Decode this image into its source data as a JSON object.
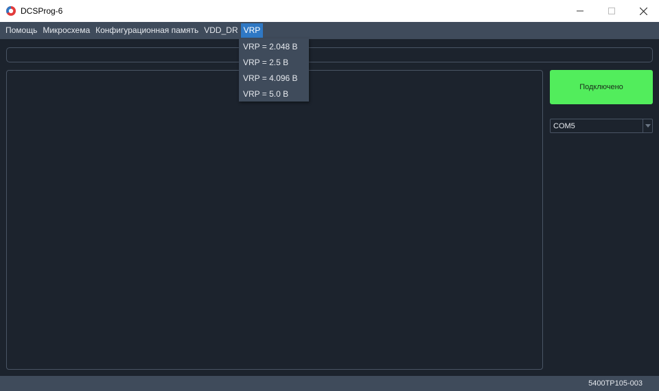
{
  "window": {
    "title": "DCSProg-6"
  },
  "menubar": {
    "items": [
      {
        "label": "Помощь"
      },
      {
        "label": "Микросхема"
      },
      {
        "label": "Конфигурационная память"
      },
      {
        "label": "VDD_DR"
      },
      {
        "label": "VRP"
      }
    ],
    "active_index": 4
  },
  "vrp_menu": {
    "items": [
      {
        "label": "VRP = 2.048 В"
      },
      {
        "label": "VRP = 2.5 В"
      },
      {
        "label": "VRP = 4.096 В"
      },
      {
        "label": "VRP = 5.0 В"
      }
    ]
  },
  "path_field": {
    "value": ""
  },
  "connect": {
    "label": "Подключено",
    "color": "#52ed5c"
  },
  "port_select": {
    "value": "COM5"
  },
  "status": {
    "text": "5400ТР105-003"
  },
  "icons": [
    "app-logo-icon",
    "minimize-icon",
    "maximize-icon",
    "close-icon",
    "chevron-down-icon"
  ],
  "colors": {
    "background": "#1c232d",
    "menubar": "#3f4b5b",
    "menu_active": "#2f78c4",
    "text": "#e6e9ee"
  }
}
